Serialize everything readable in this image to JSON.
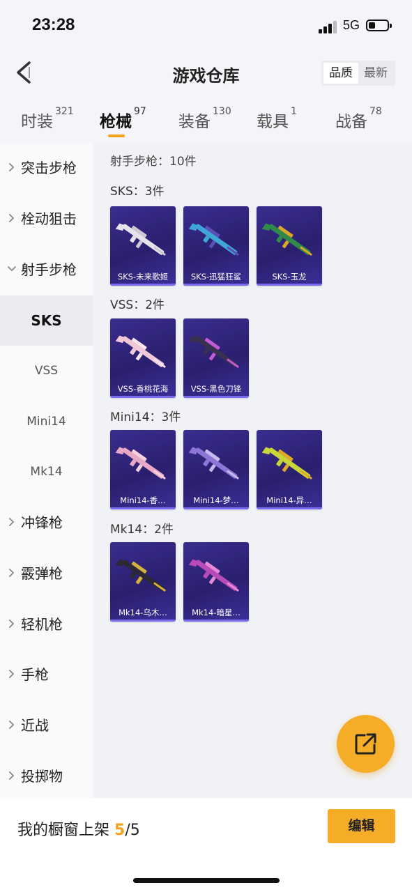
{
  "status": {
    "time": "23:28",
    "network": "5G"
  },
  "header": {
    "title": "游戏仓库",
    "sort": {
      "active": "品质",
      "inactive": "最新"
    }
  },
  "tabs": [
    {
      "label": "时装",
      "count": "321"
    },
    {
      "label": "枪械",
      "count": "97"
    },
    {
      "label": "装备",
      "count": "130"
    },
    {
      "label": "载具",
      "count": "1"
    },
    {
      "label": "战备",
      "count": "78"
    }
  ],
  "sidebar": {
    "items": [
      {
        "label": "突击步枪"
      },
      {
        "label": "栓动狙击"
      },
      {
        "label": "射手步枪"
      },
      {
        "label": "冲锋枪"
      },
      {
        "label": "霰弹枪"
      },
      {
        "label": "轻机枪"
      },
      {
        "label": "手枪"
      },
      {
        "label": "近战"
      },
      {
        "label": "投掷物"
      }
    ],
    "subitems": [
      {
        "label": "SKS"
      },
      {
        "label": "VSS"
      },
      {
        "label": "Mini14"
      },
      {
        "label": "Mk14"
      }
    ]
  },
  "content": {
    "heading": "射手步枪：10件",
    "groups": [
      {
        "title": "SKS：3件",
        "items": [
          {
            "name": "SKS-未来歌姬",
            "skin": "#e8e2ea",
            "accent": "#cfc6d6"
          },
          {
            "name": "SKS-迅猛狂鲨",
            "skin": "#3fa6d8",
            "accent": "#5b4fb8"
          },
          {
            "name": "SKS-玉龙",
            "skin": "#2f8a4a",
            "accent": "#d9a72a"
          }
        ]
      },
      {
        "title": "VSS：2件",
        "items": [
          {
            "name": "VSS-香桃花海",
            "skin": "#f0c8d8",
            "accent": "#f7e4ec"
          },
          {
            "name": "VSS-黑色刀锋",
            "skin": "#3a3050",
            "accent": "#c45bd6"
          }
        ]
      },
      {
        "title": "Mini14：3件",
        "items": [
          {
            "name": "Mini14-香…",
            "skin": "#e9a9c6",
            "accent": "#f4d0e0"
          },
          {
            "name": "Mini14-梦…",
            "skin": "#8c77d6",
            "accent": "#c7b8f0"
          },
          {
            "name": "Mini14-异…",
            "skin": "#c9d63a",
            "accent": "#e0a82a"
          }
        ]
      },
      {
        "title": "Mk14：2件",
        "items": [
          {
            "name": "Mk14-乌木…",
            "skin": "#2c2836",
            "accent": "#d4b23a"
          },
          {
            "name": "Mk14-暗星…",
            "skin": "#b84bb8",
            "accent": "#e58ad8"
          }
        ]
      }
    ]
  },
  "bottom": {
    "label": "我的橱窗上架",
    "current": "5",
    "total": "/5",
    "edit": "编辑"
  },
  "colors": {
    "accent": "#f5ac27",
    "card_bg": "#2f237a"
  }
}
